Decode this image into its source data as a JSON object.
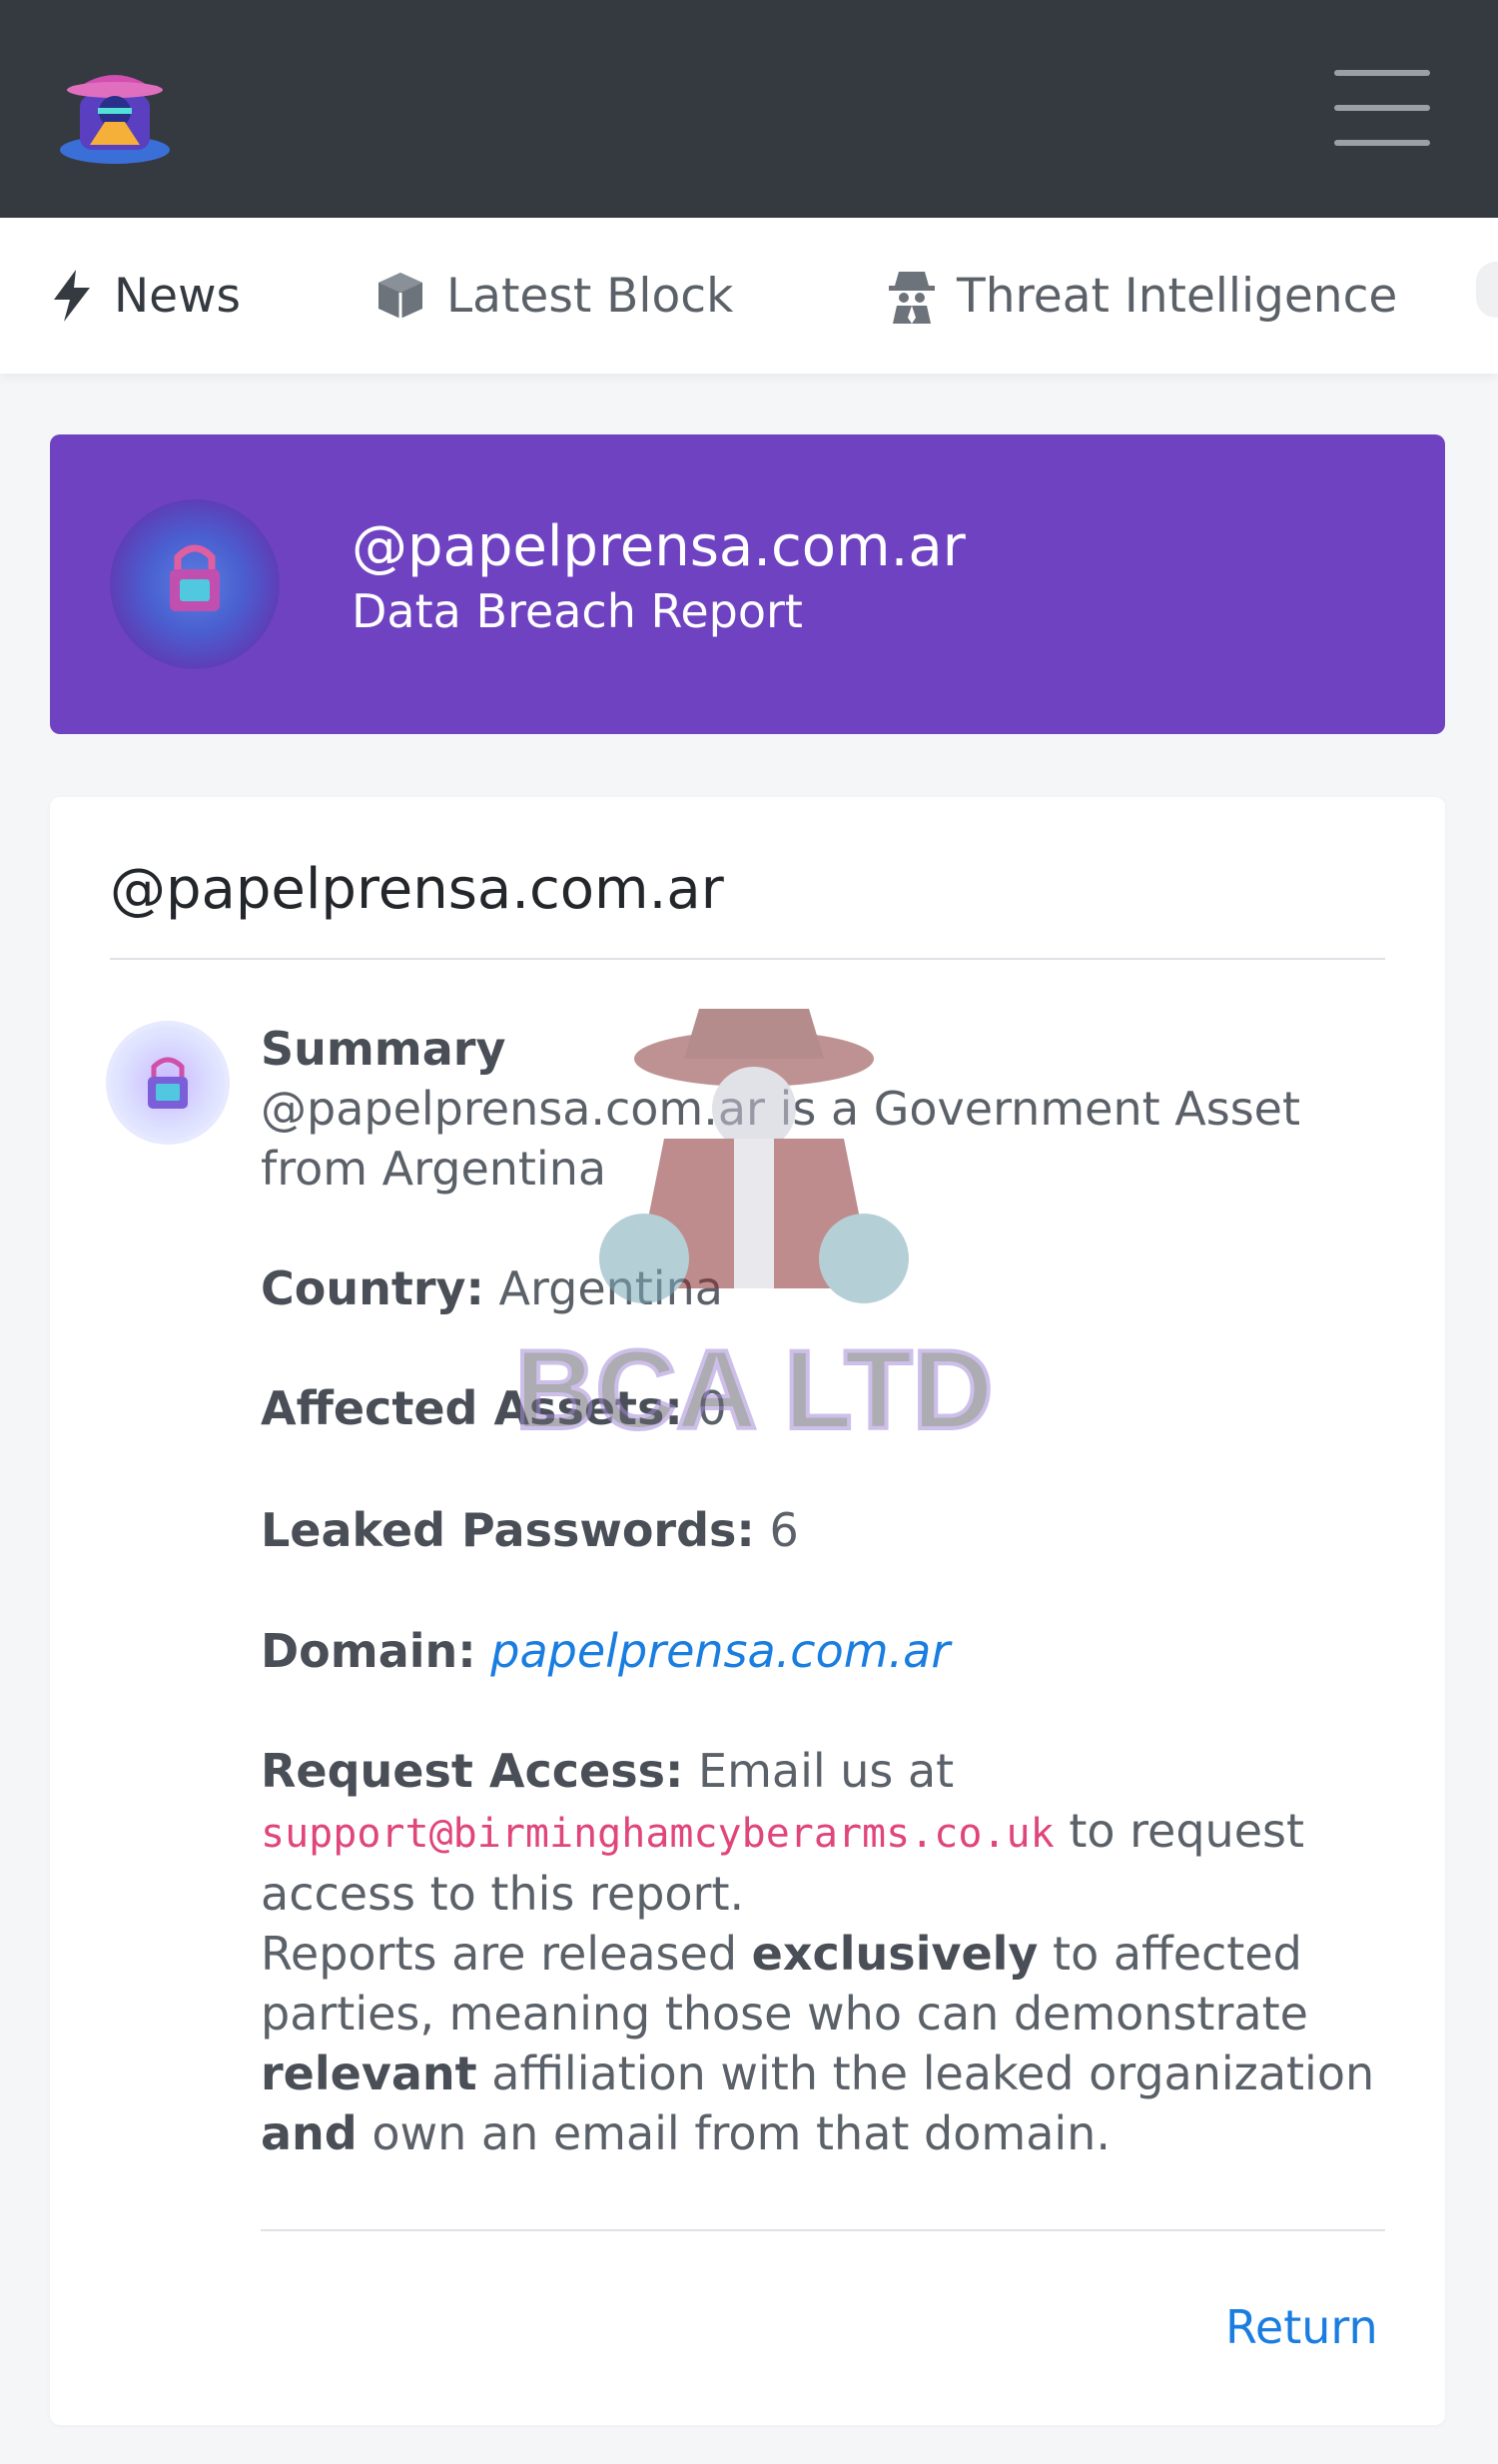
{
  "header": {
    "logo_alt": "hacker logo",
    "menu_icon": "hamburger-menu-icon"
  },
  "tabs": [
    {
      "label": "News",
      "icon": "lightning-icon"
    },
    {
      "label": "Latest Block",
      "icon": "cube-icon"
    },
    {
      "label": "Threat Intelligence",
      "icon": "spy-icon"
    }
  ],
  "banner": {
    "title": "@papelprensa.com.ar",
    "subtitle": "Data Breach Report",
    "background": "#6f42c1"
  },
  "report": {
    "title": "@papelprensa.com.ar",
    "summary_label": "Summary",
    "summary_text": "@papelprensa.com.ar is a Government Asset from Argentina",
    "country_label": "Country:",
    "country_value": "Argentina",
    "assets_label": "Affected Assets:",
    "assets_value": "0",
    "passwords_label": "Leaked Passwords:",
    "passwords_value": "6",
    "domain_label": "Domain:",
    "domain_value": "papelprensa.com.ar",
    "request_label": "Request Access:",
    "request_pre": "Email us at",
    "request_email": "support@birminghamcyberarms.co.uk",
    "request_post": "to request access to this report.",
    "policy_1": "Reports are released",
    "policy_2": "exclusively",
    "policy_3": "to affected parties, meaning those who can demonstrate",
    "policy_4": "relevant",
    "policy_5": "affiliation with the leaked organization",
    "policy_6": "and",
    "policy_7": "own an email from that domain.",
    "return_label": "Return"
  },
  "watermark": {
    "text": "BCA LTD"
  },
  "colors": {
    "topbar": "#343a40",
    "link": "#1a7de0",
    "email": "#e0457b"
  }
}
